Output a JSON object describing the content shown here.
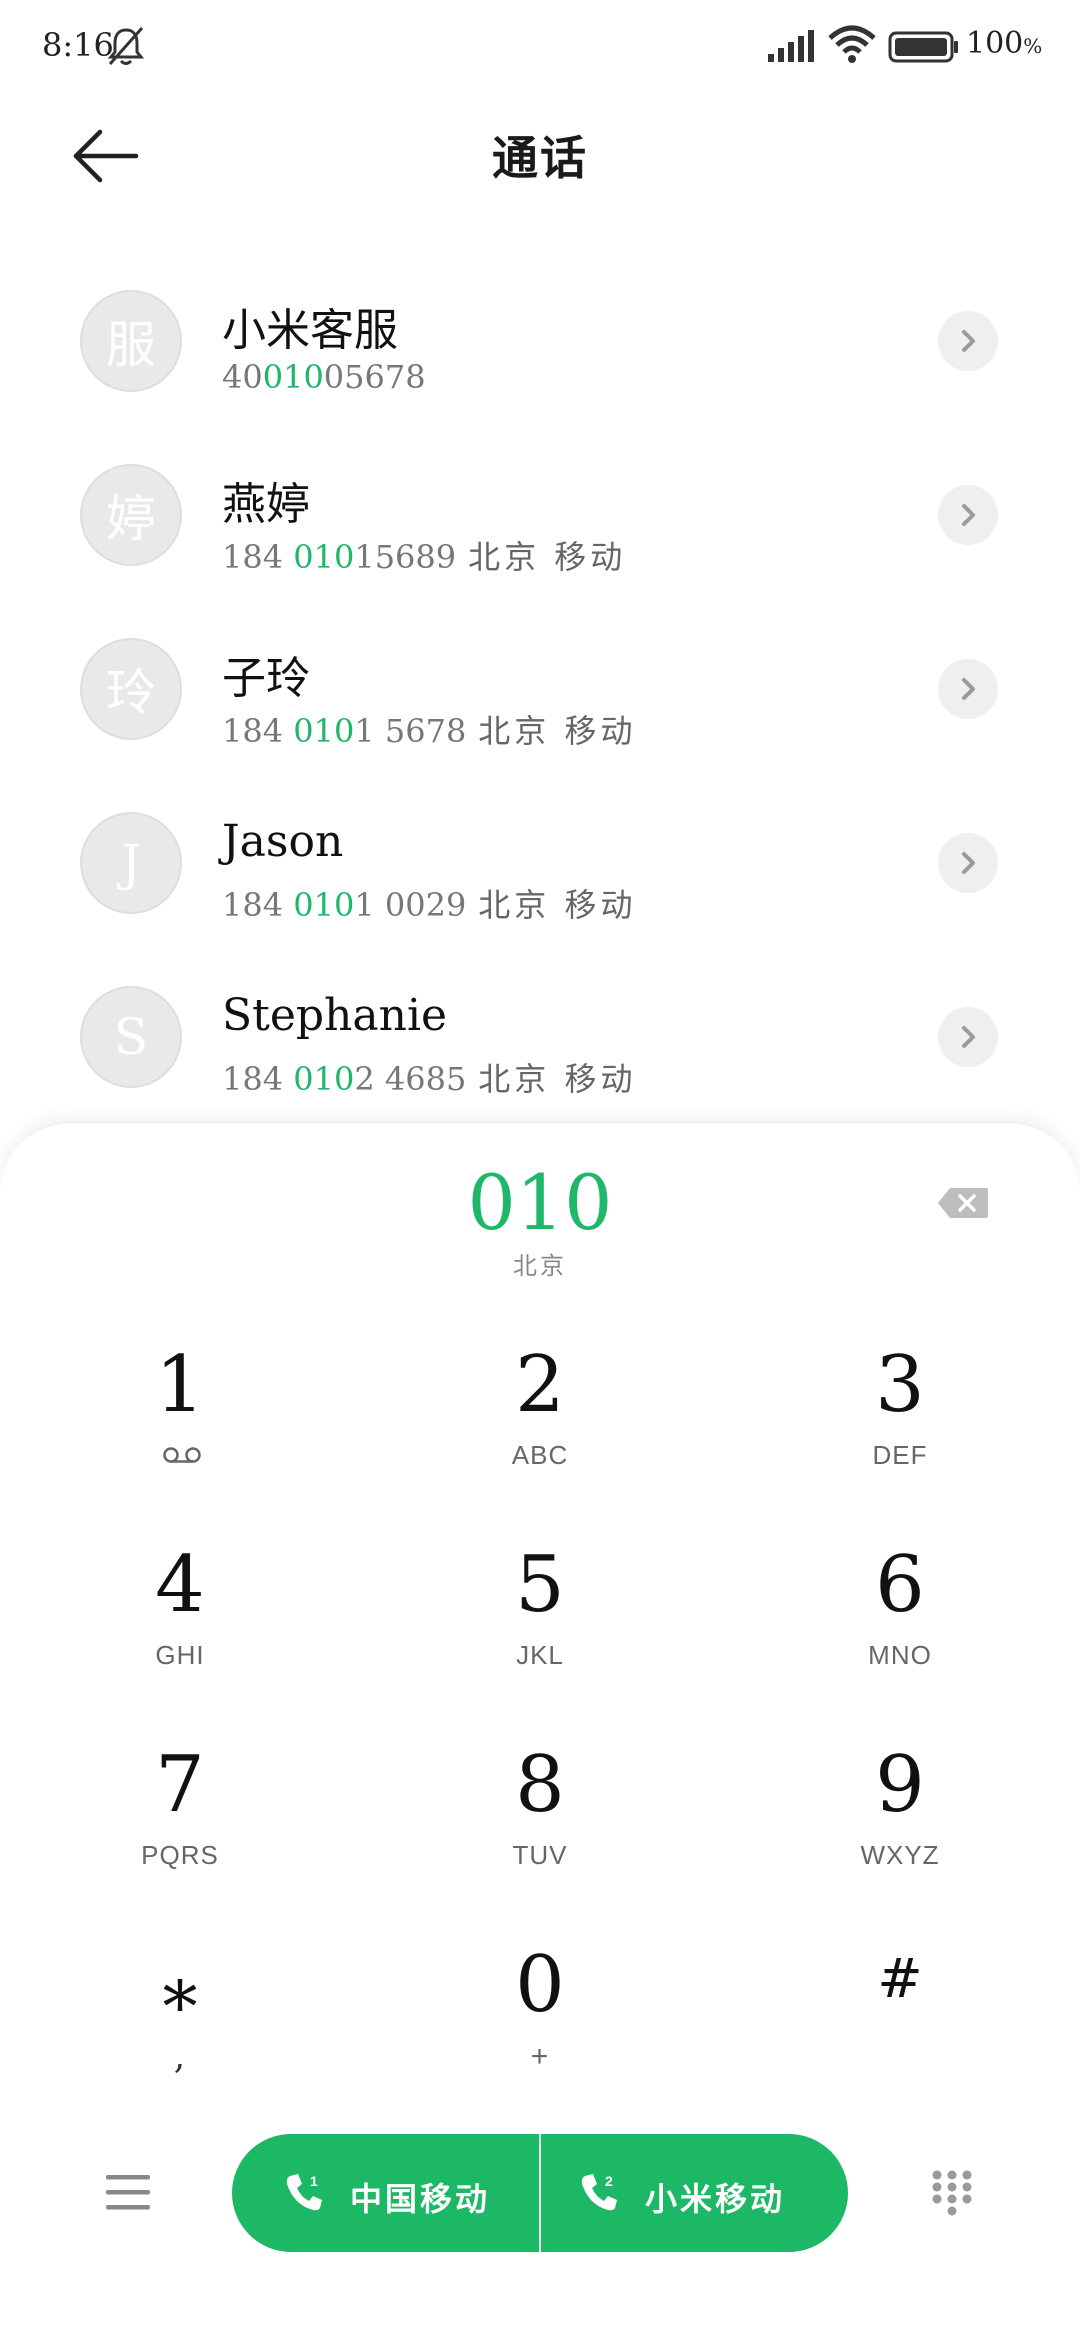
{
  "status_bar": {
    "time": "8:16",
    "battery_value": "100",
    "battery_unit": "%",
    "icons": [
      "bell-off-icon",
      "signal-icon",
      "wifi-icon",
      "battery-icon"
    ]
  },
  "header": {
    "title": "通话",
    "back_icon": "arrow-left-icon"
  },
  "contacts": [
    {
      "avatar": "服",
      "name": "小米客服",
      "num_pre": "40",
      "num_hl": "010",
      "num_post": "05678",
      "location": ""
    },
    {
      "avatar": "婷",
      "name": "燕婷",
      "num_pre": "184 ",
      "num_hl": "010",
      "num_post": "15689",
      "location": "北京 移动"
    },
    {
      "avatar": "玲",
      "name": "子玲",
      "num_pre": "184 ",
      "num_hl": "010",
      "num_post": "1 5678",
      "location": "北京 移动"
    },
    {
      "avatar": "J",
      "name": "Jason",
      "num_pre": "184 ",
      "num_hl": "010",
      "num_post": "1 0029",
      "location": "北京 移动"
    },
    {
      "avatar": "S",
      "name": "Stephanie",
      "num_pre": "184 ",
      "num_hl": "010",
      "num_post": "2 4685",
      "location": "北京 移动"
    }
  ],
  "dialer": {
    "number": "010",
    "region": "北京",
    "keys": [
      {
        "digit": "1",
        "letters": "ꝏ"
      },
      {
        "digit": "2",
        "letters": "ABC"
      },
      {
        "digit": "3",
        "letters": "DEF"
      },
      {
        "digit": "4",
        "letters": "GHI"
      },
      {
        "digit": "5",
        "letters": "JKL"
      },
      {
        "digit": "6",
        "letters": "MNO"
      },
      {
        "digit": "7",
        "letters": "PQRS"
      },
      {
        "digit": "8",
        "letters": "TUV"
      },
      {
        "digit": "9",
        "letters": "WXYZ"
      },
      {
        "digit": "*",
        "letters": ","
      },
      {
        "digit": "0",
        "letters": "+"
      },
      {
        "digit": "#",
        "letters": ""
      }
    ]
  },
  "bottom_bar": {
    "sim1_label": "中国移动",
    "sim1_index": "1",
    "sim2_label": "小米移动",
    "sim2_index": "2",
    "accent_color": "#1db866",
    "highlight_color": "#1fb86a"
  }
}
